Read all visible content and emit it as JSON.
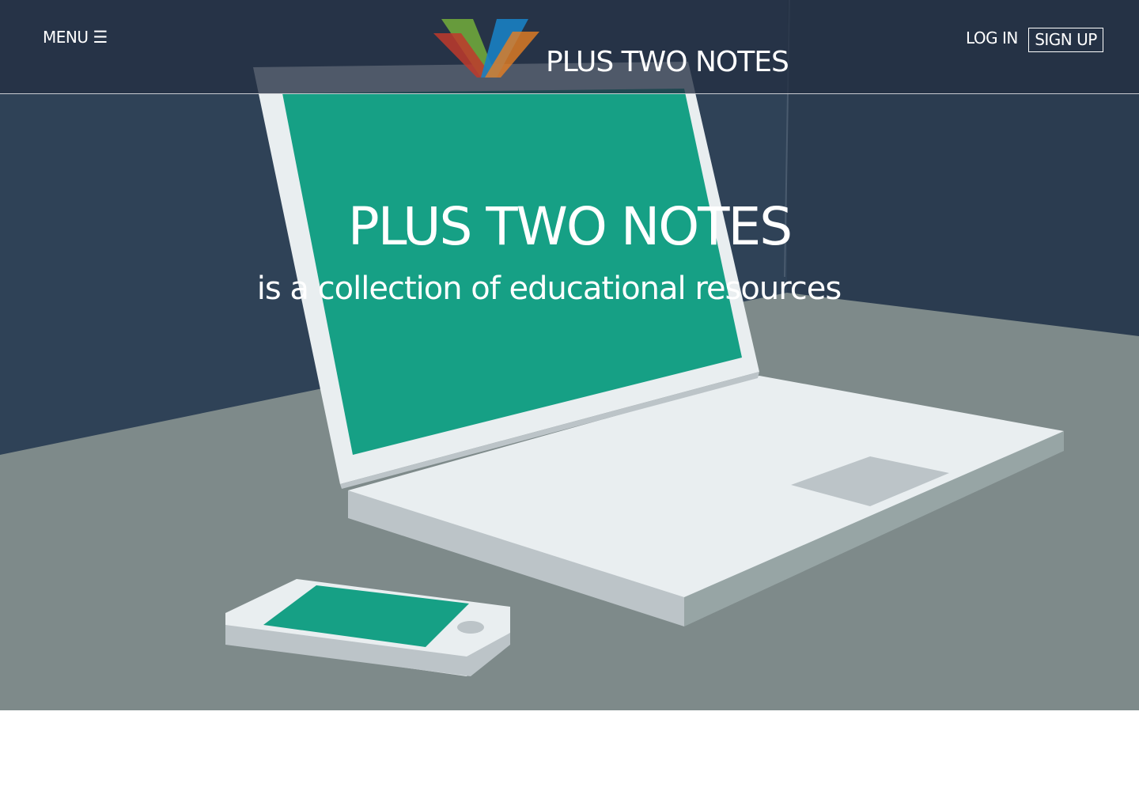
{
  "header": {
    "menu_label": "MENU",
    "menu_icon": "☰",
    "brand_title": "PLUS TWO NOTES",
    "login_label": "LOG IN",
    "signup_label": "SIGN UP"
  },
  "hero": {
    "title": "PLUS TWO NOTES",
    "subtitle": "is a collection of educational resources"
  },
  "colors": {
    "navbar": "#243042",
    "wall": "#2f4257",
    "desk": "#7e8a8a",
    "screen": "#16a085",
    "device_body": "#e9eef0",
    "logo_green": "#6aa13c",
    "logo_blue": "#1a7fc2",
    "logo_red": "#c0392b",
    "logo_orange": "#e67e22"
  },
  "icons": {
    "menu": "hamburger-icon",
    "logo": "v-logo-icon"
  }
}
